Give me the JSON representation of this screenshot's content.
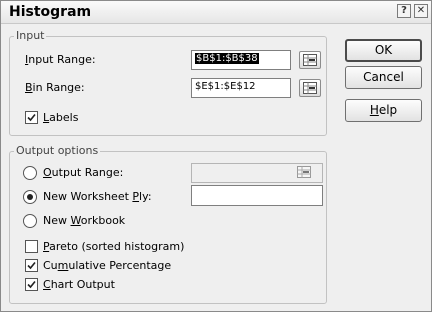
{
  "window": {
    "title": "Histogram",
    "help_glyph": "?",
    "close_glyph": "✕"
  },
  "input_group": {
    "legend": "Input",
    "input_range": {
      "label_pre": "",
      "label_key": "I",
      "label_post": "nput Range:",
      "value": "$B$1:$B$38",
      "selected": true
    },
    "bin_range": {
      "label_pre": "",
      "label_key": "B",
      "label_post": "in Range:",
      "value": "$E$1:$E$12"
    },
    "labels": {
      "label_pre": "",
      "label_key": "L",
      "label_post": "abels",
      "checked": true
    }
  },
  "output_group": {
    "legend": "Output options",
    "output_range": {
      "label_pre": "",
      "label_key": "O",
      "label_post": "utput Range:",
      "value": "",
      "selected": false
    },
    "new_worksheet": {
      "label_pre": "New Worksheet ",
      "label_key": "P",
      "label_post": "ly:",
      "value": "",
      "selected": true
    },
    "new_workbook": {
      "label_pre": "New ",
      "label_key": "W",
      "label_post": "orkbook",
      "selected": false
    },
    "pareto": {
      "label_pre": "",
      "label_key": "P",
      "label_post": "areto (sorted histogram)",
      "checked": false
    },
    "cumulative": {
      "label_pre": "Cu",
      "label_key": "m",
      "label_post": "ulative Percentage",
      "checked": true
    },
    "chart_output": {
      "label_pre": "",
      "label_key": "C",
      "label_post": "hart Output",
      "checked": true
    }
  },
  "buttons": {
    "ok": "OK",
    "cancel": "Cancel",
    "help_pre": "",
    "help_key": "H",
    "help_post": "elp"
  },
  "icons": {
    "range_picker": "collapse-dialog-icon",
    "check": "checkmark-icon"
  }
}
